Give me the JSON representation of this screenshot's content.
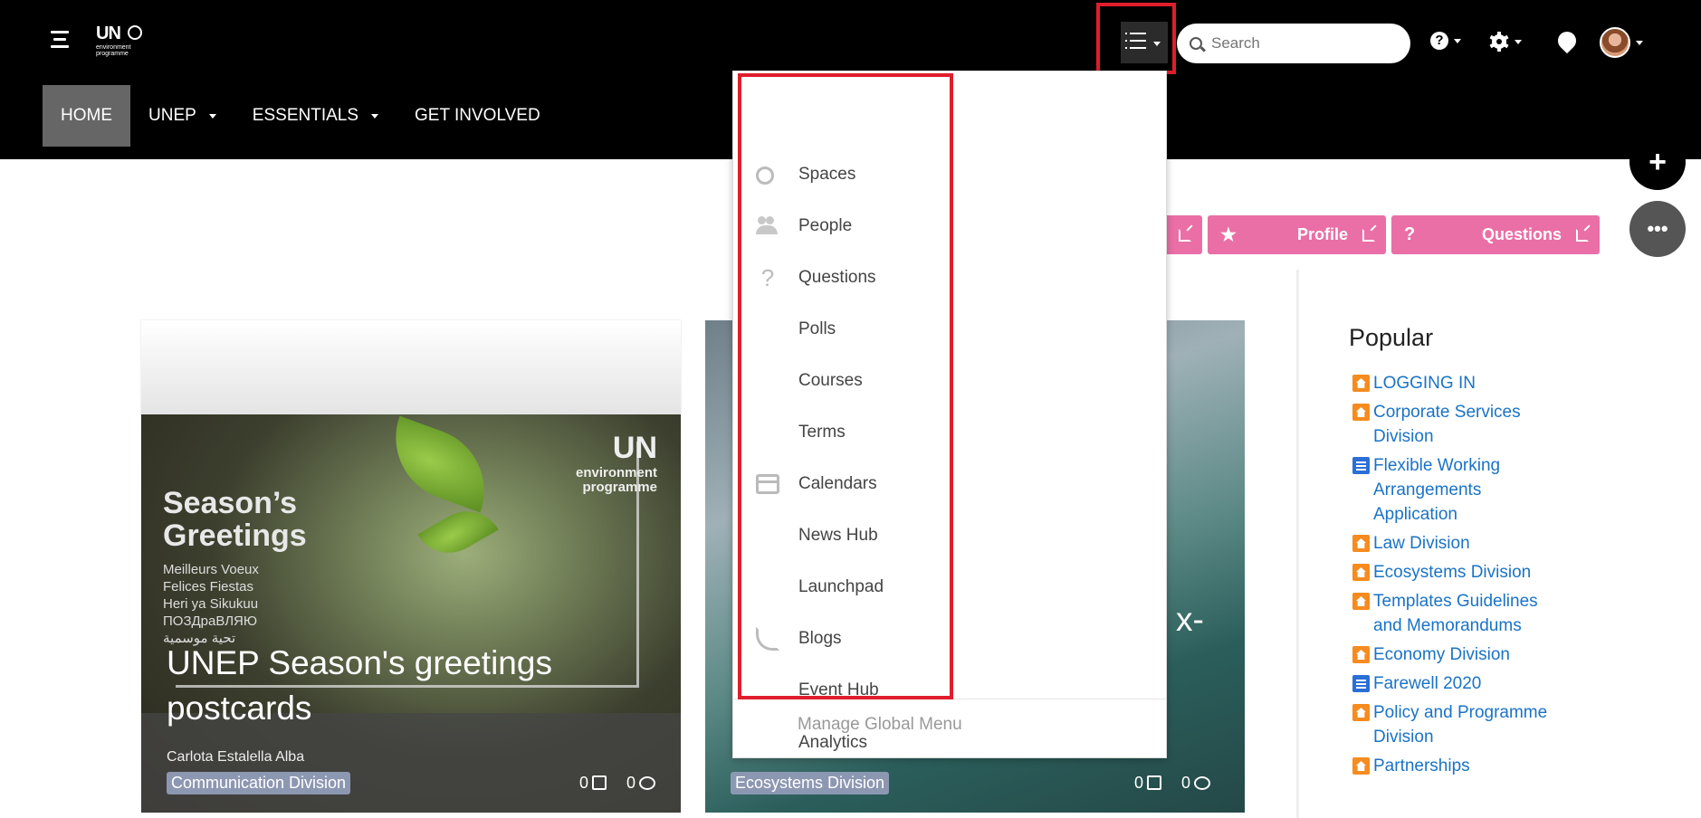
{
  "header": {
    "logo": {
      "line1": "UN",
      "line2": "environment",
      "line3": "programme"
    },
    "search_placeholder": "Search",
    "help_symbol": "?"
  },
  "nav": {
    "items": [
      {
        "label": "HOME",
        "active": true
      },
      {
        "label": "UNEP",
        "has_caret": true
      },
      {
        "label": "ESSENTIALS",
        "has_caret": true
      },
      {
        "label": "GET INVOLVED"
      }
    ]
  },
  "fab": {
    "plus": "+",
    "more": "•••"
  },
  "quick_buttons": [
    {
      "label": "",
      "icon": "external-link-icon"
    },
    {
      "label": "Profile",
      "lead": "★",
      "icon": "star-icon"
    },
    {
      "label": "Questions",
      "lead": "?",
      "icon": "question-icon"
    }
  ],
  "cards": [
    {
      "image_text": {
        "big": [
          "Season’s",
          "Greetings"
        ],
        "small": [
          "Meilleurs Voeux",
          "Felices Fiestas",
          "Heri ya Sikukuu",
          "ПОЗДраВЛЯЮ",
          "تحية موسمية"
        ],
        "logo_un": "UN",
        "logo_sub": [
          "environment",
          "programme"
        ]
      },
      "title": "UNEP Season's greetings postcards",
      "author": "Carlota Estalella Alba",
      "tag": "Communication Division",
      "likes": "0",
      "comments": "0"
    },
    {
      "title_fragment": "x-",
      "tag": "Ecosystems Division",
      "likes": "0",
      "comments": "0"
    }
  ],
  "sidebar": {
    "title": "Popular",
    "items": [
      {
        "label": "LOGGING IN",
        "type": "space"
      },
      {
        "label": "Corporate Services Division",
        "type": "space"
      },
      {
        "label": "Flexible Working Arrangements Application",
        "type": "doc"
      },
      {
        "label": "Law Division",
        "type": "space"
      },
      {
        "label": "Ecosystems Division",
        "type": "space"
      },
      {
        "label": "Templates Guidelines and Memorandums",
        "type": "space"
      },
      {
        "label": "Economy Division",
        "type": "space"
      },
      {
        "label": "Farewell 2020",
        "type": "doc"
      },
      {
        "label": "Policy and Programme Division",
        "type": "space"
      },
      {
        "label": "Partnerships",
        "type": "space"
      }
    ]
  },
  "global_menu": {
    "items": [
      {
        "label": "Spaces",
        "icon": "spaces-icon"
      },
      {
        "label": "People",
        "icon": "people-icon"
      },
      {
        "label": "Questions",
        "icon": "question-icon"
      },
      {
        "label": "Polls",
        "icon": ""
      },
      {
        "label": "Courses",
        "icon": ""
      },
      {
        "label": "Terms",
        "icon": ""
      },
      {
        "label": "Calendars",
        "icon": "calendar-icon"
      },
      {
        "label": "News Hub",
        "icon": ""
      },
      {
        "label": "Launchpad",
        "icon": ""
      },
      {
        "label": "Blogs",
        "icon": "blog-icon"
      },
      {
        "label": "Event Hub",
        "icon": ""
      },
      {
        "label": "Analytics",
        "icon": ""
      }
    ],
    "manage_label": "Manage Global Menu"
  },
  "colors": {
    "header_bg": "#000000",
    "nav_active": "#666666",
    "pink": "#e96fa6",
    "highlight_red": "#e01e2d",
    "link_blue": "#1a73c6",
    "space_orange": "#f68b1f",
    "doc_blue": "#2b6fd6"
  }
}
